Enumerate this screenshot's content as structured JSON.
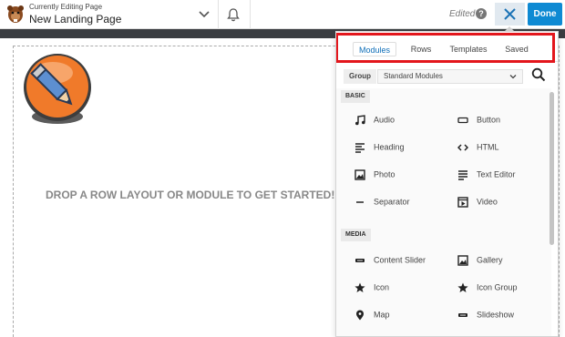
{
  "header": {
    "subtitle": "Currently Editing Page",
    "page_title": "New Landing Page",
    "status": "Edited",
    "help_glyph": "?",
    "done_label": "Done"
  },
  "canvas": {
    "prompt": "DROP A ROW LAYOUT OR MODULE TO GET STARTED!"
  },
  "panel": {
    "tabs": [
      "Modules",
      "Rows",
      "Templates",
      "Saved"
    ],
    "active_tab": "Modules",
    "group_label": "Group",
    "group_value": "Standard Modules",
    "sections": [
      {
        "title": "BASIC",
        "items": [
          {
            "label": "Audio",
            "icon": "audio-icon"
          },
          {
            "label": "Button",
            "icon": "button-icon"
          },
          {
            "label": "Heading",
            "icon": "heading-icon"
          },
          {
            "label": "HTML",
            "icon": "html-icon"
          },
          {
            "label": "Photo",
            "icon": "photo-icon"
          },
          {
            "label": "Text Editor",
            "icon": "text-editor-icon"
          },
          {
            "label": "Separator",
            "icon": "separator-icon"
          },
          {
            "label": "Video",
            "icon": "video-icon"
          }
        ]
      },
      {
        "title": "MEDIA",
        "items": [
          {
            "label": "Content Slider",
            "icon": "content-slider-icon"
          },
          {
            "label": "Gallery",
            "icon": "gallery-icon"
          },
          {
            "label": "Icon",
            "icon": "star-icon"
          },
          {
            "label": "Icon Group",
            "icon": "star-icon"
          },
          {
            "label": "Map",
            "icon": "map-pin-icon"
          },
          {
            "label": "Slideshow",
            "icon": "slideshow-icon"
          }
        ]
      }
    ]
  },
  "colors": {
    "accent": "#0e8ad3",
    "highlight": "#e3161c",
    "logo_orange": "#f07a2a"
  }
}
